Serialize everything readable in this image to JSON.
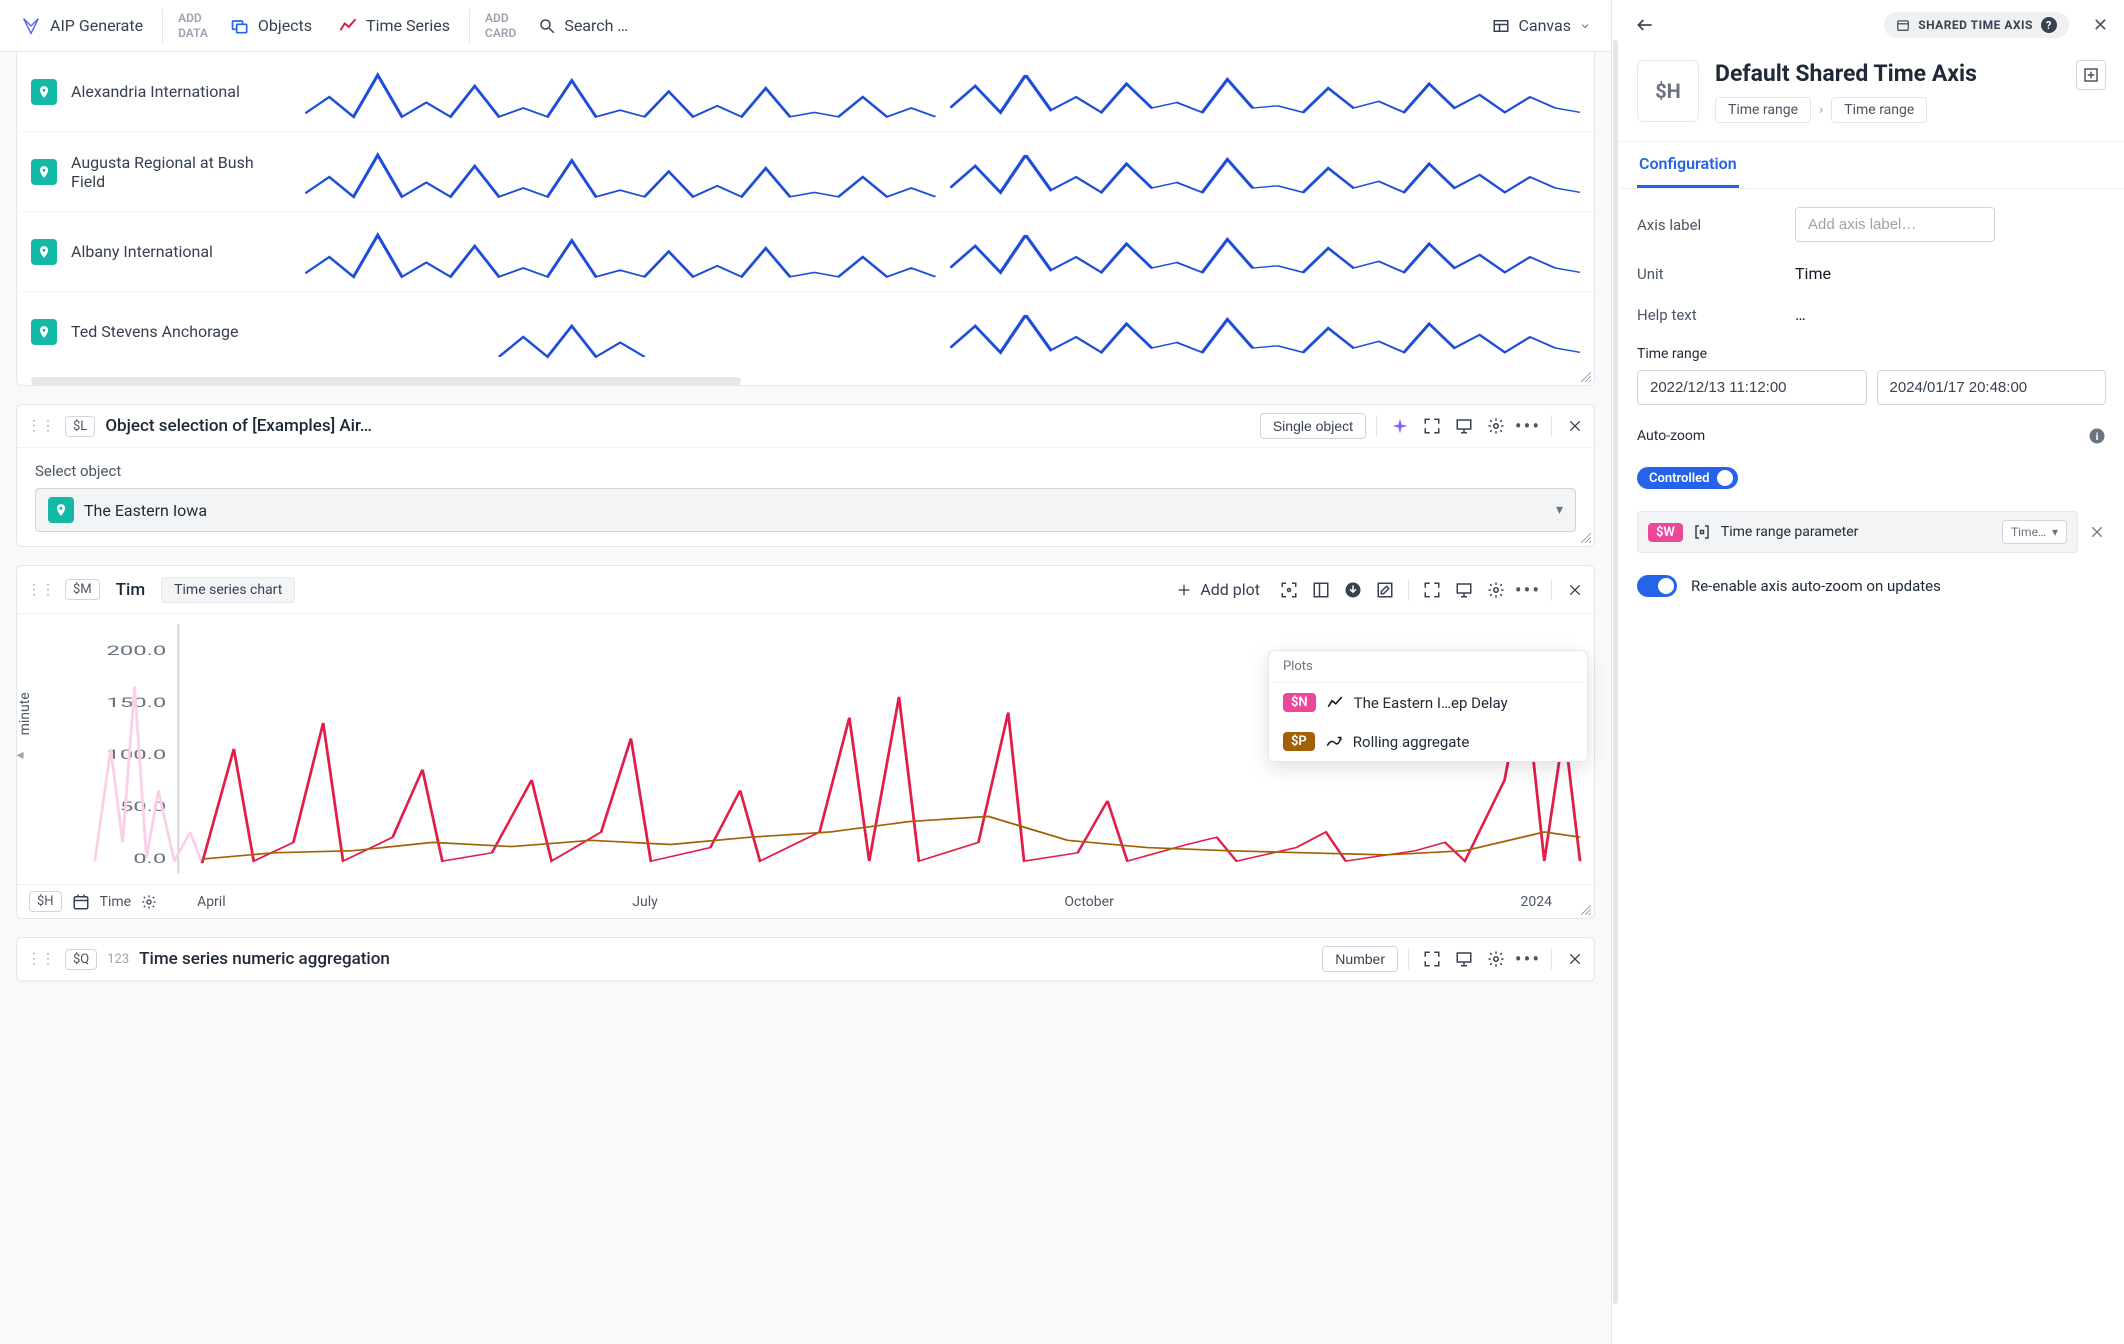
{
  "toolbar": {
    "aip": "AIP Generate",
    "add_data": "ADD\nDATA",
    "objects": "Objects",
    "timeseries": "Time Series",
    "add_card": "ADD\nCARD",
    "search": "Search …",
    "canvas": "Canvas"
  },
  "airports": [
    {
      "name": "Alexandria International"
    },
    {
      "name": "Augusta Regional at Bush Field"
    },
    {
      "name": "Albany International"
    },
    {
      "name": "Ted Stevens Anchorage"
    }
  ],
  "cardL": {
    "var": "$L",
    "title": "Object selection of [Examples] Air…",
    "pill": "Single object",
    "field_label": "Select object",
    "selected": "The Eastern Iowa"
  },
  "cardM": {
    "var": "$M",
    "title": "Tim",
    "pill": "Time series chart",
    "add_plot": "Add plot",
    "ylabel": "minute",
    "plots_header": "Plots",
    "plotN": {
      "var": "$N",
      "label": "The Eastern I…ep Delay"
    },
    "plotP": {
      "var": "$P",
      "label": "Rolling aggregate"
    },
    "footer_var": "$H",
    "footer_label": "Time",
    "xticks": [
      "April",
      "July",
      "October",
      "2024"
    ]
  },
  "cardQ": {
    "var": "$Q",
    "title": "Time series numeric aggregation",
    "pill": "Number"
  },
  "chart_data": {
    "type": "line",
    "title": "",
    "xlabel": "",
    "ylabel": "minute",
    "ylim": [
      0,
      210
    ],
    "yticks": [
      0.0,
      50.0,
      100.0,
      150.0,
      200.0
    ],
    "xticks": [
      "April",
      "July",
      "October",
      "2024"
    ],
    "series": [
      {
        "name": "The Eastern I…ep Delay",
        "color": "#e11d48"
      },
      {
        "name": "Rolling aggregate",
        "color": "#a16207"
      }
    ],
    "note": "Spiky minute-delay series roughly 0–50 baseline with peaks ~100–200; rolling aggregate smoother ~5–40. Exact per-point values not legible."
  },
  "side": {
    "chip": "SHARED TIME AXIS",
    "var": "$H",
    "title": "Default Shared Time Axis",
    "crumb1": "Time range",
    "crumb2": "Time range",
    "tab": "Configuration",
    "axis_label_lbl": "Axis label",
    "axis_label_ph": "Add axis label…",
    "unit_lbl": "Unit",
    "unit_val": "Time",
    "help_lbl": "Help text",
    "help_val": "…",
    "timerange_lbl": "Time range",
    "start": "2022/12/13 11:12:00",
    "end": "2024/01/17 20:48:00",
    "autozoom_lbl": "Auto-zoom",
    "controlled": "Controlled",
    "param_var": "$W",
    "param_label": "Time range parameter",
    "param_select": "Time…",
    "reenable": "Re-enable axis auto-zoom on updates"
  }
}
